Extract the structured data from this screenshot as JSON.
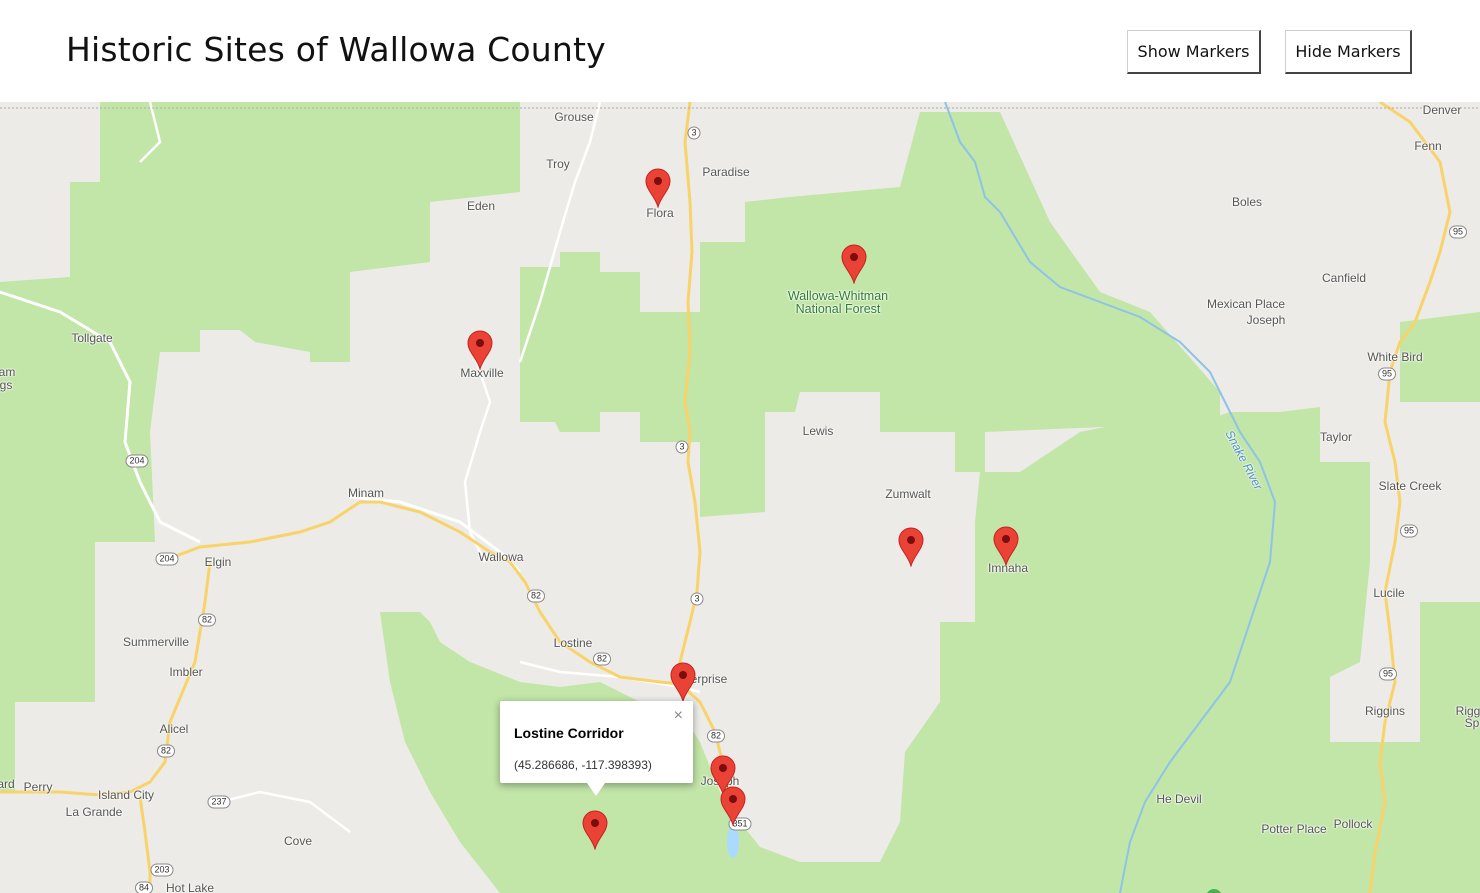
{
  "header": {
    "title": "Historic Sites of Wallowa County",
    "show_markers_label": "Show Markers",
    "hide_markers_label": "Hide Markers"
  },
  "map": {
    "places": [
      {
        "id": "grouse",
        "text": "Grouse"
      },
      {
        "id": "troy",
        "text": "Troy"
      },
      {
        "id": "paradise",
        "text": "Paradise"
      },
      {
        "id": "flora",
        "text": "Flora"
      },
      {
        "id": "eden",
        "text": "Eden"
      },
      {
        "id": "denver",
        "text": "Denver"
      },
      {
        "id": "fenn",
        "text": "Fenn"
      },
      {
        "id": "boles",
        "text": "Boles"
      },
      {
        "id": "canfield",
        "text": "Canfield"
      },
      {
        "id": "mexican-place",
        "text": "Mexican Place"
      },
      {
        "id": "joseph-id",
        "text": "Joseph"
      },
      {
        "id": "white-bird",
        "text": "White Bird"
      },
      {
        "id": "tollgate",
        "text": "Tollgate"
      },
      {
        "id": "maxville",
        "text": "Maxville"
      },
      {
        "id": "lewis",
        "text": "Lewis"
      },
      {
        "id": "taylor",
        "text": "Taylor"
      },
      {
        "id": "zumwalt",
        "text": "Zumwalt"
      },
      {
        "id": "slate-creek",
        "text": "Slate Creek"
      },
      {
        "id": "minam",
        "text": "Minam"
      },
      {
        "id": "elgin",
        "text": "Elgin"
      },
      {
        "id": "wallowa",
        "text": "Wallowa"
      },
      {
        "id": "imnaha",
        "text": "Imnaha"
      },
      {
        "id": "lucile",
        "text": "Lucile"
      },
      {
        "id": "summerville",
        "text": "Summerville"
      },
      {
        "id": "lostine",
        "text": "Lostine"
      },
      {
        "id": "imbler",
        "text": "Imbler"
      },
      {
        "id": "enterprise",
        "text": "Enterprise"
      },
      {
        "id": "riggins",
        "text": "Riggins"
      },
      {
        "id": "alicel",
        "text": "Alicel"
      },
      {
        "id": "joseph",
        "text": "Joseph"
      },
      {
        "id": "perry",
        "text": "Perry"
      },
      {
        "id": "island-city",
        "text": "Island City"
      },
      {
        "id": "la-grande",
        "text": "La Grande"
      },
      {
        "id": "cove",
        "text": "Cove"
      },
      {
        "id": "he-devil",
        "text": "He Devil"
      },
      {
        "id": "potter-place",
        "text": "Potter Place"
      },
      {
        "id": "pollock",
        "text": "Pollock"
      },
      {
        "id": "hot-lake",
        "text": "Hot Lake"
      },
      {
        "id": "ard",
        "text": "ard"
      },
      {
        "id": "am",
        "text": "am"
      },
      {
        "id": "gs",
        "text": "gs"
      },
      {
        "id": "rigg",
        "text": "Rigg"
      },
      {
        "id": "sp",
        "text": "Sp"
      }
    ],
    "park_label_line1": "Wallowa-Whitman",
    "park_label_line2": "National Forest",
    "river_label": "Snake River",
    "route_shields": [
      "3",
      "3",
      "3",
      "204",
      "204",
      "82",
      "82",
      "82",
      "82",
      "82",
      "237",
      "203",
      "84",
      "95",
      "95",
      "95",
      "95",
      "351"
    ],
    "marker_color": "#ea4335",
    "forest_color": "#c2e5a8",
    "land_color": "#ecebe7"
  },
  "popup": {
    "title": "Lostine Corridor",
    "coords": "(45.286686, -117.398393)",
    "close_icon": "×"
  }
}
